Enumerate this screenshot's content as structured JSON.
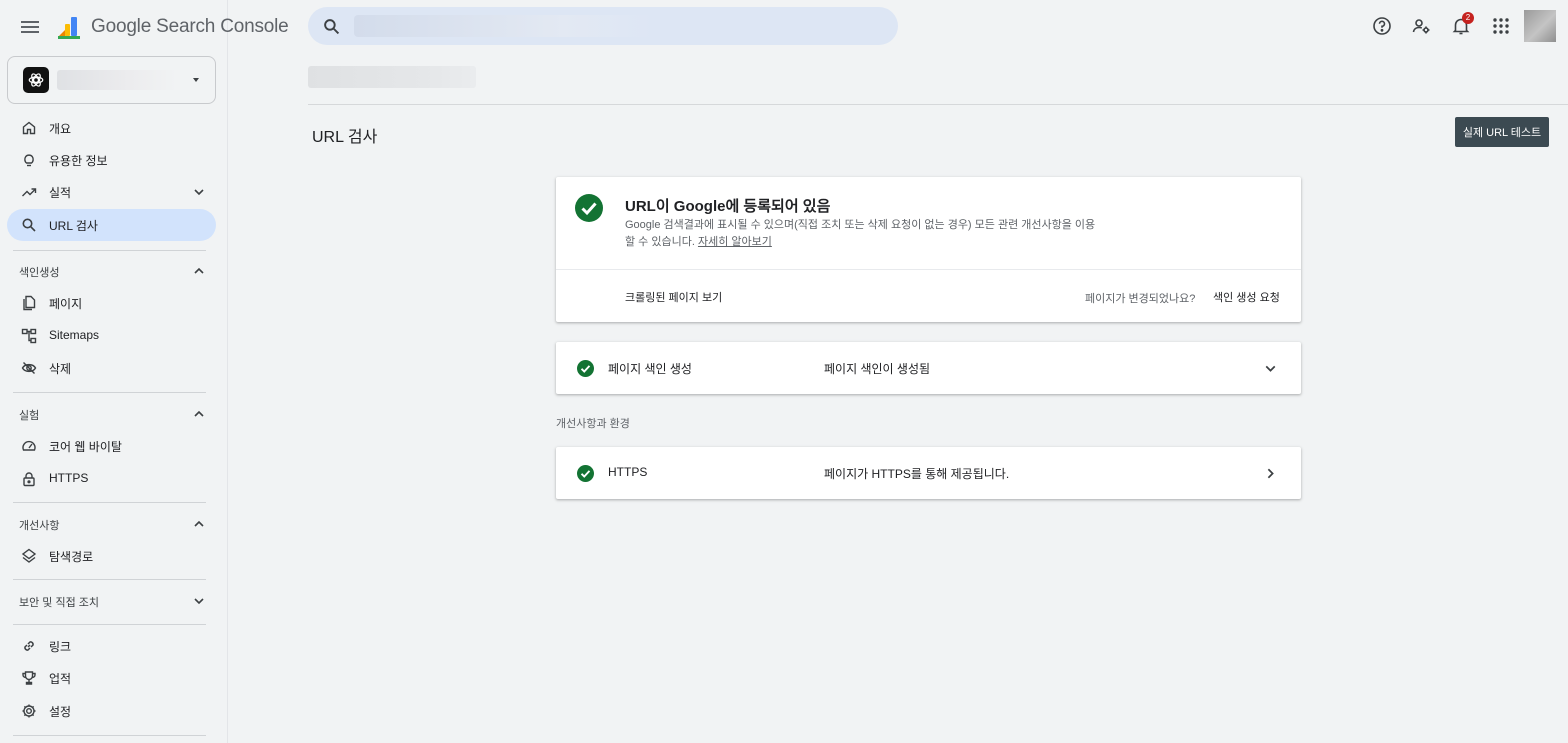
{
  "app": {
    "product_name": "Google Search Console",
    "brand_colors": {
      "blue": "#4285f4",
      "yellow": "#fbbc04",
      "orange": "#ea8600"
    }
  },
  "header": {
    "search": {
      "placeholder": "",
      "icon": "search-icon"
    },
    "icons": [
      "help-icon",
      "manage-users-icon",
      "notifications-icon",
      "apps-icon"
    ],
    "notification_count": "2"
  },
  "sidebar": {
    "property_icon": "openai-logo",
    "items": [
      {
        "label": "개요",
        "icon": "home-icon"
      },
      {
        "label": "유용한 정보",
        "icon": "lightbulb-icon"
      },
      {
        "label": "실적",
        "icon": "trending-up-icon",
        "expandable": true
      },
      {
        "label": "URL 검사",
        "icon": "search-icon",
        "active": true
      }
    ],
    "sections": {
      "indexing": {
        "label": "색인생성",
        "items": [
          {
            "label": "페이지",
            "icon": "pages-icon"
          },
          {
            "label": "Sitemaps",
            "icon": "sitemap-icon"
          },
          {
            "label": "삭제",
            "icon": "visibility-off-icon"
          }
        ]
      },
      "experience": {
        "label": "실험",
        "items": [
          {
            "label": "코어 웹 바이탈",
            "icon": "speed-icon"
          },
          {
            "label": "HTTPS",
            "icon": "lock-icon"
          }
        ]
      },
      "enhancements": {
        "label": "개선사항",
        "items": [
          {
            "label": "탐색경로",
            "icon": "layers-icon"
          }
        ]
      },
      "security": {
        "label": "보안 및 직접 조치"
      }
    },
    "bottom_items": [
      {
        "label": "링크",
        "icon": "link-icon"
      },
      {
        "label": "업적",
        "icon": "trophy-icon"
      },
      {
        "label": "설정",
        "icon": "settings-icon"
      }
    ]
  },
  "main": {
    "page_title": "URL 검사",
    "live_test_button": "실제 URL 테스트",
    "status": {
      "heading": "URL이 Google에 등록되어 있음",
      "description": "Google 검색결과에 표시될 수 있으며(직접 조치 또는 삭제 요청이 없는 경우) 모든 관련 개선사항을 이용할 수 있습니다. ",
      "learn_more": "자세히 알아보기",
      "view_crawled": "크롤링된 페이지 보기",
      "changed_question": "페이지가 변경되었나요?",
      "request_indexing": "색인 생성 요청",
      "status_color": "#137333"
    },
    "indexing_row": {
      "name": "페이지 색인 생성",
      "value": "페이지 색인이 생성됨"
    },
    "enhancements_label": "개선사항과 환경",
    "https_row": {
      "name": "HTTPS",
      "value": "페이지가 HTTPS를 통해 제공됩니다."
    }
  }
}
